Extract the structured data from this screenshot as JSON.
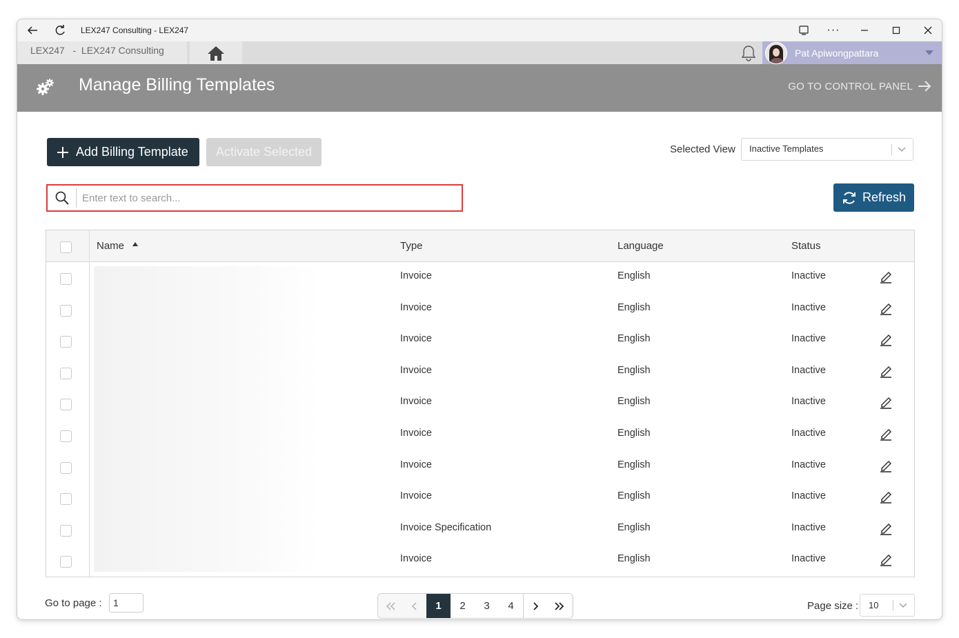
{
  "window": {
    "title": "LEX247 Consulting - LEX247"
  },
  "tabs": {
    "breadcrumb": "LEX247   -  LEX247 Consulting"
  },
  "user": {
    "name": "Pat Apiwongpattara"
  },
  "header": {
    "title": "Manage Billing Templates",
    "goto_label": "GO TO CONTROL PANEL"
  },
  "toolbar": {
    "add_label": "Add Billing Template",
    "activate_label": "Activate Selected",
    "selected_view_label": "Selected View",
    "selected_view_value": "Inactive Templates",
    "refresh_label": "Refresh"
  },
  "search": {
    "placeholder": "Enter text to search..."
  },
  "grid": {
    "columns": [
      "Name",
      "Type",
      "Language",
      "Status"
    ],
    "rows": [
      {
        "type": "Invoice",
        "language": "English",
        "status": "Inactive"
      },
      {
        "type": "Invoice",
        "language": "English",
        "status": "Inactive"
      },
      {
        "type": "Invoice",
        "language": "English",
        "status": "Inactive"
      },
      {
        "type": "Invoice",
        "language": "English",
        "status": "Inactive"
      },
      {
        "type": "Invoice",
        "language": "English",
        "status": "Inactive"
      },
      {
        "type": "Invoice",
        "language": "English",
        "status": "Inactive"
      },
      {
        "type": "Invoice",
        "language": "English",
        "status": "Inactive"
      },
      {
        "type": "Invoice",
        "language": "English",
        "status": "Inactive"
      },
      {
        "type": "Invoice Specification",
        "language": "English",
        "status": "Inactive"
      },
      {
        "type": "Invoice",
        "language": "English",
        "status": "Inactive"
      }
    ]
  },
  "pager": {
    "goto_label": "Go to page :",
    "goto_value": "1",
    "pages": [
      "1",
      "2",
      "3",
      "4"
    ],
    "current": "1",
    "page_size_label": "Page size :",
    "page_size_value": "10"
  },
  "colors": {
    "primary_dark": "#23343f",
    "refresh_blue": "#1e5a82",
    "header_gray": "#8f8f8f",
    "search_border": "#e0393e",
    "user_bg": "#b3b3d6"
  }
}
